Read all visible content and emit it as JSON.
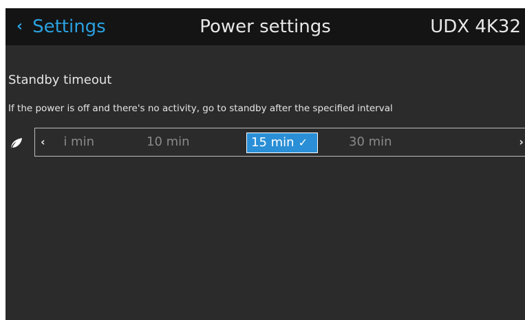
{
  "header": {
    "back_label": "Settings",
    "title": "Power settings",
    "device": "UDX 4K32"
  },
  "standby": {
    "title": "Standby timeout",
    "description": "If the power is off and there's no activity, go to standby after the specified interval",
    "options": [
      "i min",
      "10 min",
      "15 min",
      "30 min"
    ],
    "selected": "15 min",
    "check": "✓",
    "left_arrow": "‹",
    "right_arrow": "›"
  },
  "colors": {
    "accent": "#2aa1e0",
    "selection": "#2a8fd6",
    "background": "#2b2b2b",
    "header": "#141414"
  },
  "icons": {
    "back": "chevron-left-icon",
    "eco": "leaf-icon",
    "selected": "check-icon"
  }
}
